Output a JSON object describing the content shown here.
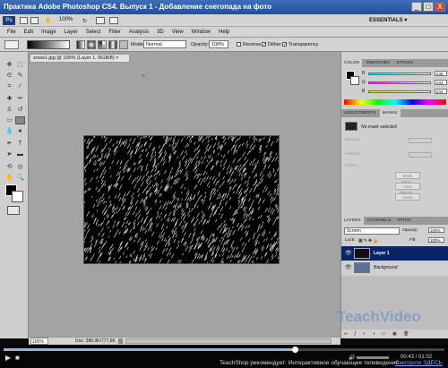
{
  "window": {
    "title": "Практика Adobe Photoshop CS4. Выпуск 1 - Добавление снегопада на фото",
    "minimize": "_",
    "maximize": "□",
    "close": "X"
  },
  "appbar": {
    "ps_logo": "Ps",
    "zoom": "100%",
    "essentials": "ESSENTIALS ▾"
  },
  "menu": [
    "File",
    "Edit",
    "Image",
    "Layer",
    "Select",
    "Filter",
    "Analysis",
    "3D",
    "View",
    "Window",
    "Help"
  ],
  "options": {
    "mode_label": "Mode:",
    "mode_value": "Normal",
    "opacity_label": "Opacity:",
    "opacity_value": "100%",
    "reverse": "Reverse",
    "dither": "Dither",
    "transparency": "Transparency"
  },
  "document": {
    "tab_title": "snow1.jpg @ 100% (Layer 1, RGB/8) ×",
    "zoom": "100%",
    "doc_info": "Doc: 386,9K/777,6K"
  },
  "color_panel": {
    "tabs": [
      "COLOR",
      "SWATCHES",
      "STYLES"
    ],
    "r_label": "R",
    "g_label": "G",
    "b_label": "B",
    "r_value": "248",
    "g_value": "244",
    "b_value": "244"
  },
  "adjustments_panel": {
    "tabs": [
      "ADJUSTMENTS",
      "MASKS"
    ],
    "no_mask": "No mask selected",
    "density": "Density:",
    "feather": "Feather:",
    "refine": "Refine:",
    "mask_edge": "Mask Edge...",
    "color_range": "Color Range...",
    "invert": "Invert"
  },
  "layers_panel": {
    "tabs": [
      "LAYERS",
      "CHANNELS",
      "PATHS"
    ],
    "blend_mode": "Screen",
    "opacity_label": "Opacity:",
    "opacity_value": "100%",
    "lock_label": "Lock:",
    "fill_label": "Fill:",
    "fill_value": "100%",
    "layers": [
      {
        "name": "Layer 1",
        "selected": true
      },
      {
        "name": "Background",
        "selected": false
      }
    ]
  },
  "watermark": "TeachVideo",
  "player": {
    "time": "00:43 / 01:02",
    "promo": "TeachShop рекомендует: Интерактивное обучающее телевидение",
    "link": "Смотрите ЗДЕСЬ",
    "progress": 0.66
  },
  "colors": {
    "title_bar": "#2a5ca8",
    "selected_layer": "#0a246a",
    "link": "#7fa7ff"
  }
}
